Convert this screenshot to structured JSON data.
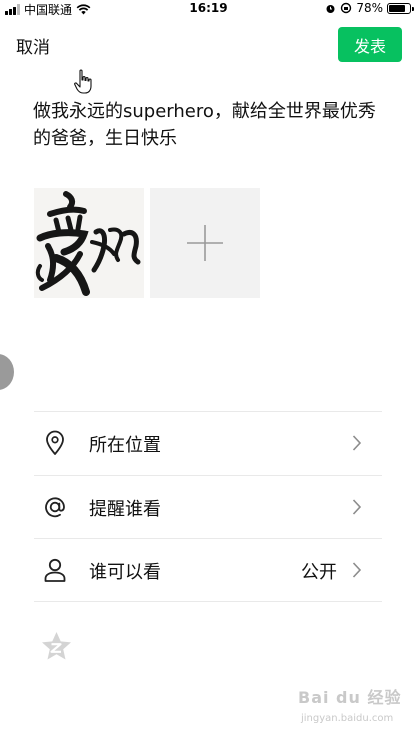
{
  "status_bar": {
    "carrier": "中国联通",
    "time": "16:19",
    "battery": "78%",
    "battery_level": 0.78,
    "icons": [
      "signal-icon",
      "wifi-icon",
      "alarm-icon",
      "orientation-lock-icon",
      "battery-icon"
    ]
  },
  "header": {
    "cancel_label": "取消",
    "publish_label": "发表"
  },
  "post": {
    "text": "做我永远的superhero，献给全世界最优秀的爸爸，生日快乐"
  },
  "photos": {
    "thumbnail_icon": "calligraphy-image",
    "add_icon": "plus-icon"
  },
  "options": [
    {
      "label": "所在位置",
      "value": "",
      "icon": "location-pin-icon"
    },
    {
      "label": "提醒谁看",
      "value": "",
      "icon": "at-icon"
    },
    {
      "label": "谁可以看",
      "value": "公开",
      "icon": "person-icon"
    }
  ],
  "colors": {
    "accent": "#07c160",
    "divider": "#e9e9e9",
    "add_tile": "#f2f2f2"
  },
  "watermark": {
    "text": "Bai du 经验",
    "url": "jingyan.baidu.com"
  }
}
